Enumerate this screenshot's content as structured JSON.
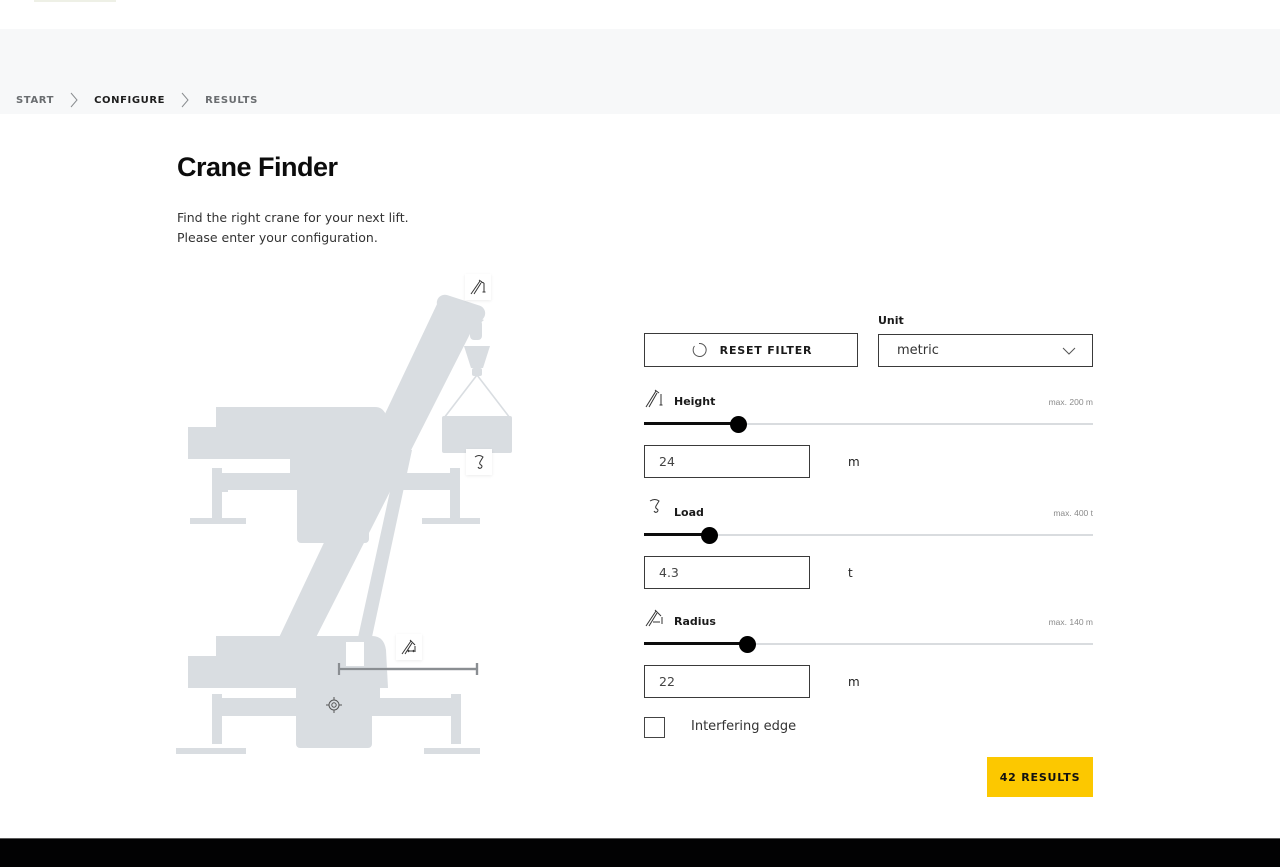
{
  "breadcrumb": {
    "items": [
      {
        "label": "START",
        "active": false
      },
      {
        "label": "CONFIGURE",
        "active": true
      },
      {
        "label": "RESULTS",
        "active": false
      }
    ],
    "separator_icon": "chevron-right-icon"
  },
  "page": {
    "title": "Crane Finder",
    "intro_line1": "Find the right crane for your next lift.",
    "intro_line2": "Please enter your configuration."
  },
  "illustration": {
    "description": "crane-silhouette",
    "badges": [
      "boom-height-icon",
      "hook-load-icon",
      "radius-icon",
      "pivot-target-icon"
    ]
  },
  "filters": {
    "reset_label": "RESET FILTER",
    "reset_icon": "reset-circle-icon",
    "unit_label": "Unit",
    "unit_value": "metric",
    "unit_icon": "chevron-down-icon",
    "params": [
      {
        "key": "height",
        "label": "Height",
        "icon": "boom-height-icon",
        "max_label": "max. 200 m",
        "value": "24",
        "unit": "m",
        "slider_fraction": 0.21
      },
      {
        "key": "load",
        "label": "Load",
        "icon": "hook-load-icon",
        "max_label": "max. 400 t",
        "value": "4.3",
        "unit": "t",
        "slider_fraction": 0.145
      },
      {
        "key": "radius",
        "label": "Radius",
        "icon": "radius-icon",
        "max_label": "max. 140 m",
        "value": "22",
        "unit": "m",
        "slider_fraction": 0.23
      }
    ],
    "interfering_edge_label": "Interfering edge",
    "interfering_edge_checked": false,
    "results_label": "42 RESULTS"
  },
  "colors": {
    "accent": "#fcc800",
    "crane_silhouette": "#d9dde1",
    "breadcrumb_bg": "#f7f8f9",
    "footer_bg": "#020203"
  }
}
